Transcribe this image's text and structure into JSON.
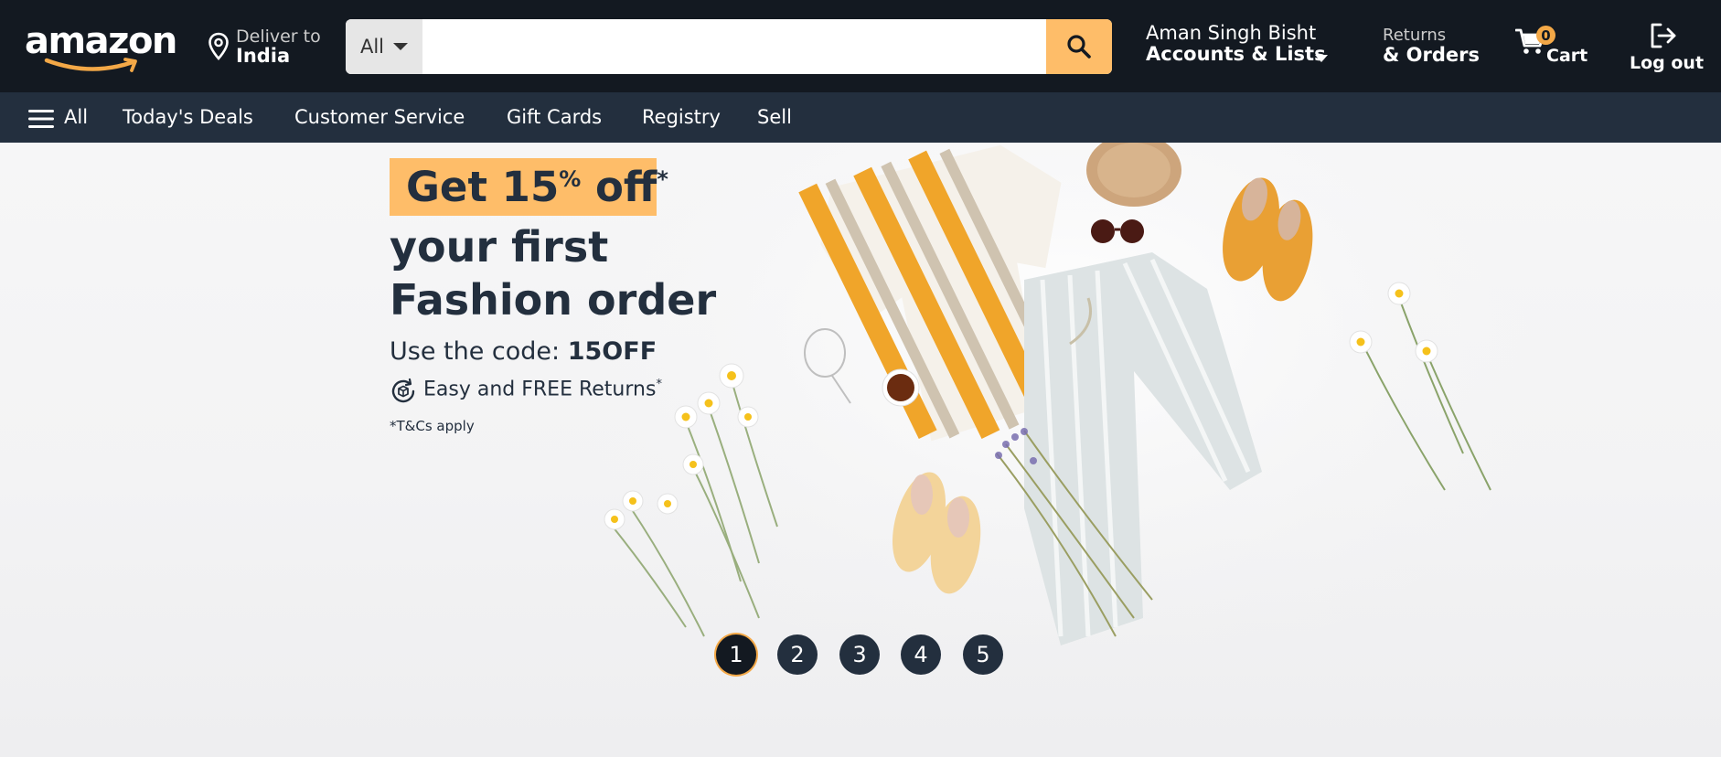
{
  "header": {
    "logo_text": "amazon",
    "deliver": {
      "line1": "Deliver to",
      "line2": "India"
    },
    "search": {
      "category": "All",
      "placeholder": "",
      "value": ""
    },
    "account": {
      "line1": "Aman Singh Bisht",
      "line2": "Accounts & Lists"
    },
    "returns": {
      "line1": "Returns",
      "line2": "& Orders"
    },
    "cart": {
      "count": "0",
      "label": "Cart"
    },
    "logout": {
      "label": "Log out"
    }
  },
  "subnav": {
    "items": [
      {
        "label": "All"
      },
      {
        "label": "Today's Deals"
      },
      {
        "label": "Customer Service"
      },
      {
        "label": "Gift Cards"
      },
      {
        "label": "Registry"
      },
      {
        "label": "Sell"
      }
    ]
  },
  "hero": {
    "badge_main": "Get 15",
    "badge_pct": "%",
    "badge_off": " off",
    "badge_star": "*",
    "headline1": "your first",
    "headline2": "Fashion order",
    "code_prefix": "Use the code: ",
    "code": "15OFF",
    "returns_text": "Easy and FREE Returns",
    "returns_star": "*",
    "terms": "*T&Cs apply"
  },
  "carousel": {
    "dots": [
      "1",
      "2",
      "3",
      "4",
      "5"
    ],
    "active": 1
  },
  "colors": {
    "header_bg": "#131921",
    "subnav_bg": "#232f3e",
    "accent": "#febd69",
    "badge_orange": "#f3a847",
    "hero_text": "#232f3e"
  },
  "icons": [
    "location-pin-icon",
    "chevron-down-icon",
    "search-icon",
    "cart-icon",
    "logout-icon",
    "hamburger-menu-icon",
    "returns-box-icon"
  ]
}
